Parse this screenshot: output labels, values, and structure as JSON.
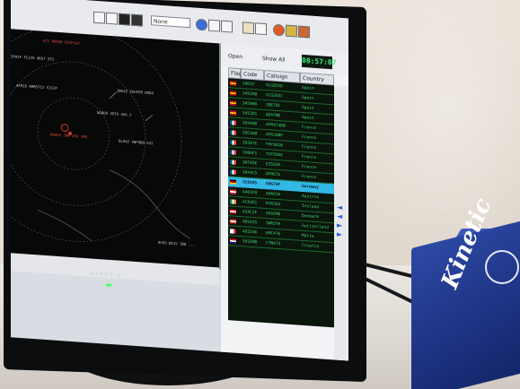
{
  "photo": {
    "subject": "monitor-showing-adsb-tracking-software",
    "colors": {
      "wall": "#e8e1d8",
      "desk": "#e2ddd7",
      "bezel": "#0c0d0f",
      "radar_bg": "#070808",
      "grid_text": "#3fd868",
      "selected_row": "#33b8e6",
      "box": "#1e3485"
    }
  },
  "toolbar": {
    "combo_value": "None"
  },
  "radar": {
    "top_label": "ATC RADAR DISPLAY",
    "tracks": [
      "SPA2F FL120 4R57 5T2",
      "AFR16 KMR5712 S1S2P",
      "IBE42 EGGFER DKD4",
      "NARDO 35T4 455.2",
      "DLH42 VNF9BQ 522",
      "BAW53 1M6 4S6 1M6",
      "ACK3 BEJS 1R8 ..."
    ]
  },
  "panel": {
    "open_label": "Open",
    "show_all_label": "Show All",
    "clock": "08:57:07",
    "columns": {
      "flag": "Flag",
      "code": "Code",
      "callsign": "Callsign",
      "country": "Country"
    },
    "rows": [
      {
        "code": "34D1F",
        "callsign": "VLG85VD",
        "country": "Spain",
        "flag": "es"
      },
      {
        "code": "3452AB",
        "callsign": "VLG2A5C",
        "country": "Spain",
        "flag": "es"
      },
      {
        "code": "345AB8",
        "callsign": "IBE7DC",
        "country": "Spain",
        "flag": "es"
      },
      {
        "code": "3452D1",
        "callsign": "AEA7ND",
        "country": "Spain",
        "flag": "es"
      },
      {
        "code": "394A0D",
        "callsign": "AFR474DN",
        "country": "France",
        "flag": "fr"
      },
      {
        "code": "39C8AB",
        "callsign": "AFR28BF",
        "country": "France",
        "flag": "fr"
      },
      {
        "code": "393A7E",
        "callsign": "FHY862B",
        "country": "France",
        "flag": "fr"
      },
      {
        "code": "3986F1",
        "callsign": "TVF95DE",
        "country": "France",
        "flag": "fr"
      },
      {
        "code": "3B7A5E",
        "callsign": "EZS83K",
        "country": "France",
        "flag": "fr"
      },
      {
        "code": "3944C5",
        "callsign": "AFR67S",
        "country": "France",
        "flag": "fr"
      },
      {
        "code": "3C6585",
        "callsign": "EWG7WF",
        "country": "Germany",
        "flag": "de"
      },
      {
        "code": "4402F8",
        "callsign": "AUA81H",
        "country": "Austria",
        "flag": "at"
      },
      {
        "code": "4CA2E1",
        "callsign": "RYR2Q4",
        "country": "Ireland",
        "flag": "ie"
      },
      {
        "code": "45AC2F",
        "callsign": "SAS6ME",
        "country": "Denmark",
        "flag": "dk"
      },
      {
        "code": "4B1815",
        "callsign": "SWR2YH",
        "country": "Switzerland",
        "flag": "ch"
      },
      {
        "code": "4D2246",
        "callsign": "AMC476",
        "country": "Malta",
        "flag": "mt"
      },
      {
        "code": "501D9B",
        "callsign": "CTN473",
        "country": "Croatia",
        "flag": "hr"
      }
    ],
    "selected_index": 10
  },
  "monitor": {
    "brand": "HANNS-G"
  },
  "device": {
    "label": "Kinetic"
  }
}
